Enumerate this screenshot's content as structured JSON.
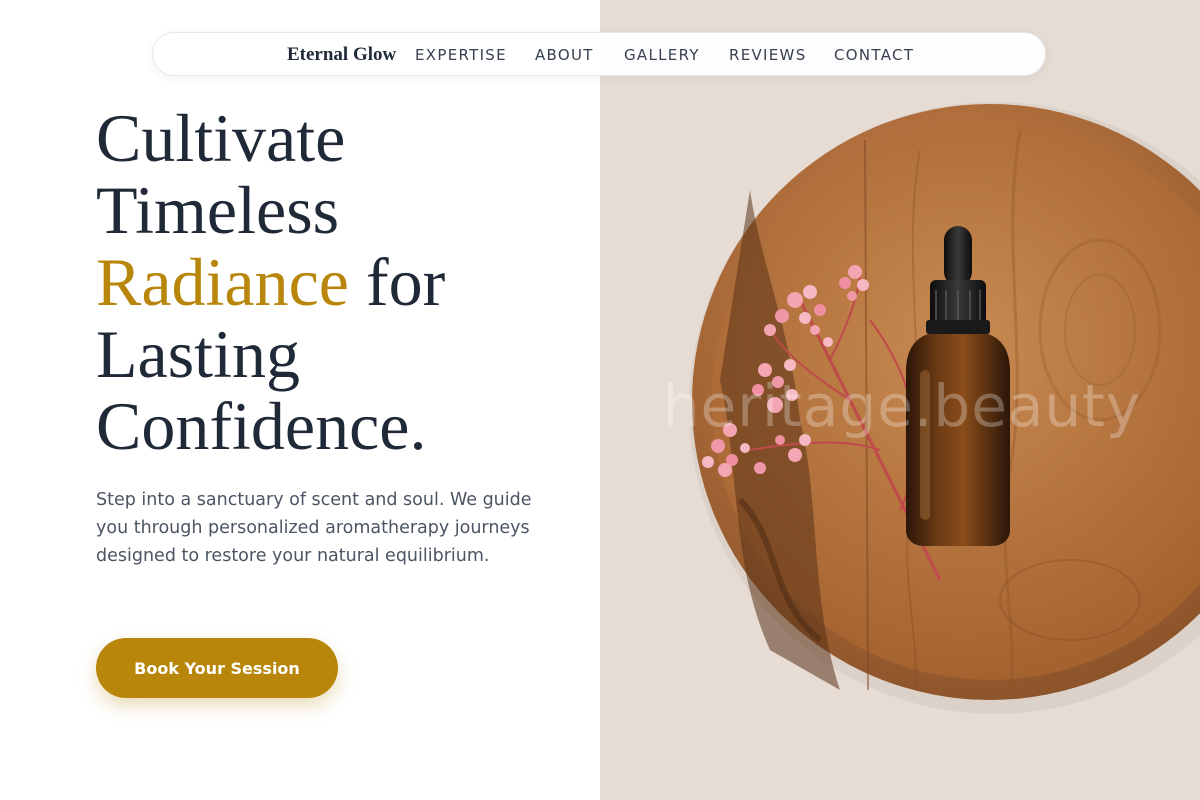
{
  "nav": {
    "brand": "Eternal Glow",
    "links": [
      "EXPERTISE",
      "ABOUT",
      "GALLERY",
      "REVIEWS",
      "CONTACT"
    ]
  },
  "hero": {
    "headline": {
      "line1": "Cultivate",
      "line2": "Timeless",
      "accent": "Radiance",
      "line3_rest": "for",
      "line4": "Lasting",
      "line5": "Confidence."
    },
    "subtext": "Step into a sanctuary of scent and soul. We guide you through personalized aromatherapy journeys designed to restore your natural equilibrium.",
    "cta_label": "Book Your Session"
  },
  "image": {
    "watermark": "heritage.beauty",
    "subject": "amber dropper bottle with pink dried flowers on a round wooden tray"
  },
  "colors": {
    "accent": "#b8860b",
    "heading": "#1f2937",
    "body": "#4b5563",
    "background": "#ffffff",
    "image_bg": "#e6dcd4"
  }
}
